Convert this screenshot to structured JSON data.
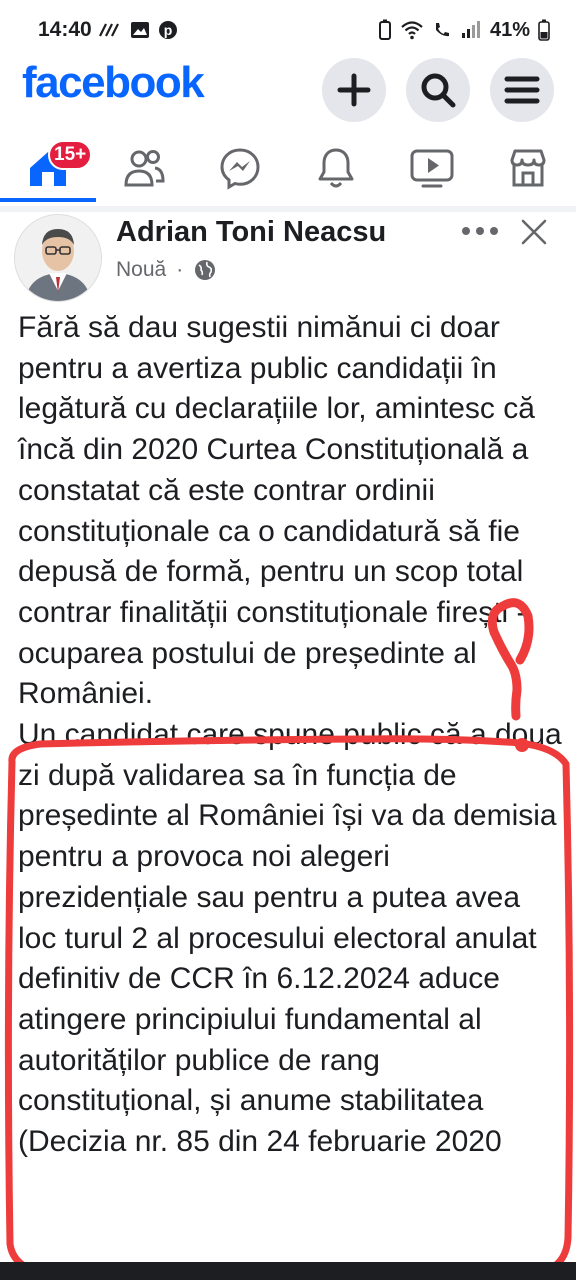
{
  "status_bar": {
    "time": "14:40",
    "battery": "41%"
  },
  "header": {
    "logo": "facebook",
    "buttons": [
      {
        "name": "create-button",
        "icon": "plus-icon"
      },
      {
        "name": "search-button",
        "icon": "search-icon"
      },
      {
        "name": "menu-button",
        "icon": "hamburger-menu-icon"
      }
    ]
  },
  "nav": {
    "home_badge": "15+",
    "tabs": [
      "home-icon",
      "friends-icon",
      "messenger-icon",
      "notifications-icon",
      "video-icon",
      "marketplace-icon"
    ]
  },
  "post": {
    "author": "Adrian Toni Neacsu",
    "time_label": "Nouă",
    "separator": "·",
    "privacy_icon": "globe-icon",
    "paragraph1": "Fără să dau sugestii nimănui ci doar pentru a avertiza public candidații în legătură cu declarațiile lor, amintesc că încă din 2020 Curtea Constituțională a constatat că este contrar ordinii constituționale ca o candidatură să fie depusă de formă, pentru un scop total contrar finalității constituționale firești - ocuparea postului de președinte al României.",
    "paragraph2": "Un candidat care spune public că a doua zi după validarea sa în funcția de președinte al României își va da demisia pentru a provoca noi alegeri prezidențiale sau pentru a putea avea loc turul 2 al procesului electoral anulat definitiv de CCR în 6.12.2024 aduce atingere principiului fundamental al autorităților publice de rang constituțional, și anume stabilitatea (Decizia nr. 85 din 24 februarie 2020"
  },
  "colors": {
    "brand": "#0866ff",
    "badge": "#e41e3f",
    "annotation": "#ee3b3b",
    "text": "#1c1e21",
    "muted": "#65676b"
  }
}
